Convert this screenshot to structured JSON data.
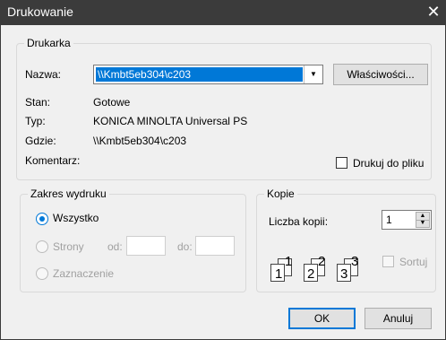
{
  "window": {
    "title": "Drukowanie",
    "close_glyph": "✕"
  },
  "printer": {
    "legend": "Drukarka",
    "name_label": "Nazwa:",
    "name_value": "\\\\Kmbt5eb304\\c203",
    "properties_button": "Właściwości...",
    "status_label": "Stan:",
    "status_value": "Gotowe",
    "type_label": "Typ:",
    "type_value": "KONICA MINOLTA Universal PS",
    "where_label": "Gdzie:",
    "where_value": "\\\\Kmbt5eb304\\c203",
    "comment_label": "Komentarz:",
    "print_to_file_label": "Drukuj do pliku",
    "print_to_file_checked": false
  },
  "range": {
    "legend": "Zakres wydruku",
    "all_label": "Wszystko",
    "pages_label": "Strony",
    "from_label": "od:",
    "to_label": "do:",
    "from_value": "",
    "to_value": "",
    "selection_label": "Zaznaczenie"
  },
  "copies": {
    "legend": "Kopie",
    "count_label": "Liczba kopii:",
    "count_value": "1",
    "collate_label": "Sortuj",
    "collate_checked": false,
    "page_icons": [
      "1",
      "1",
      "2",
      "2",
      "3",
      "3"
    ]
  },
  "buttons": {
    "ok": "OK",
    "cancel": "Anuluj"
  }
}
